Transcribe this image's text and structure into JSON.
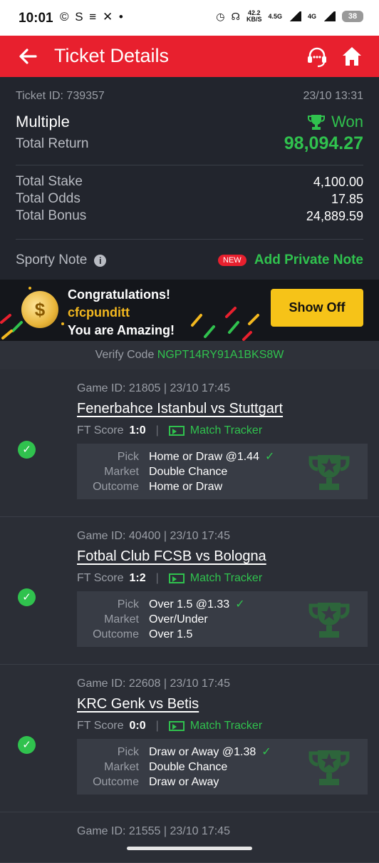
{
  "status_bar": {
    "time": "10:01",
    "left_icons": "© S ≡ ✕ •",
    "net_speed_top": "42.2",
    "net_speed_bottom": "KB/S",
    "net_4g_1": "4.5G",
    "net_4g_2": "4G",
    "battery": "38"
  },
  "header": {
    "title": "Ticket Details"
  },
  "summary": {
    "ticket_id": "Ticket ID: 739357",
    "date": "23/10 13:31",
    "bet_type": "Multiple",
    "status": "Won",
    "total_return_label": "Total Return",
    "total_return_value": "98,094.27",
    "total_stake_label": "Total Stake",
    "total_stake_value": "4,100.00",
    "total_odds_label": "Total Odds",
    "total_odds_value": "17.85",
    "total_bonus_label": "Total Bonus",
    "total_bonus_value": "24,889.59",
    "note_label": "Sporty Note",
    "new_badge": "NEW",
    "add_note": "Add Private Note"
  },
  "banner": {
    "line1": "Congratulations!",
    "username": "cfcpunditt",
    "line3": "You are Amazing!",
    "button": "Show Off"
  },
  "verify": {
    "label": "Verify Code",
    "code": "NGPT14RY91A1BKS8W"
  },
  "games": [
    {
      "meta": "Game ID: 21805 | 23/10 17:45",
      "match": "Fenerbahce Istanbul vs Stuttgart",
      "ft_label": "FT Score",
      "ft_score": "1:0",
      "tracker": "Match Tracker",
      "pick_label": "Pick",
      "market_label": "Market",
      "outcome_label": "Outcome",
      "pick": "Home or Draw @1.44",
      "market": "Double Chance",
      "outcome": "Home or Draw"
    },
    {
      "meta": "Game ID: 40400 | 23/10 17:45",
      "match": "Fotbal Club FCSB vs Bologna",
      "ft_label": "FT Score",
      "ft_score": "1:2",
      "tracker": "Match Tracker",
      "pick_label": "Pick",
      "market_label": "Market",
      "outcome_label": "Outcome",
      "pick": "Over 1.5 @1.33",
      "market": "Over/Under",
      "outcome": "Over 1.5"
    },
    {
      "meta": "Game ID: 22608 | 23/10 17:45",
      "match": "KRC Genk vs Betis",
      "ft_label": "FT Score",
      "ft_score": "0:0",
      "tracker": "Match Tracker",
      "pick_label": "Pick",
      "market_label": "Market",
      "outcome_label": "Outcome",
      "pick": "Draw or Away @1.38",
      "market": "Double Chance",
      "outcome": "Draw or Away"
    },
    {
      "meta": "Game ID: 21555 | 23/10 17:45"
    }
  ],
  "colors": {
    "brand_red": "#e8202e",
    "win_green": "#30c24e",
    "button_yellow": "#f6c318"
  }
}
